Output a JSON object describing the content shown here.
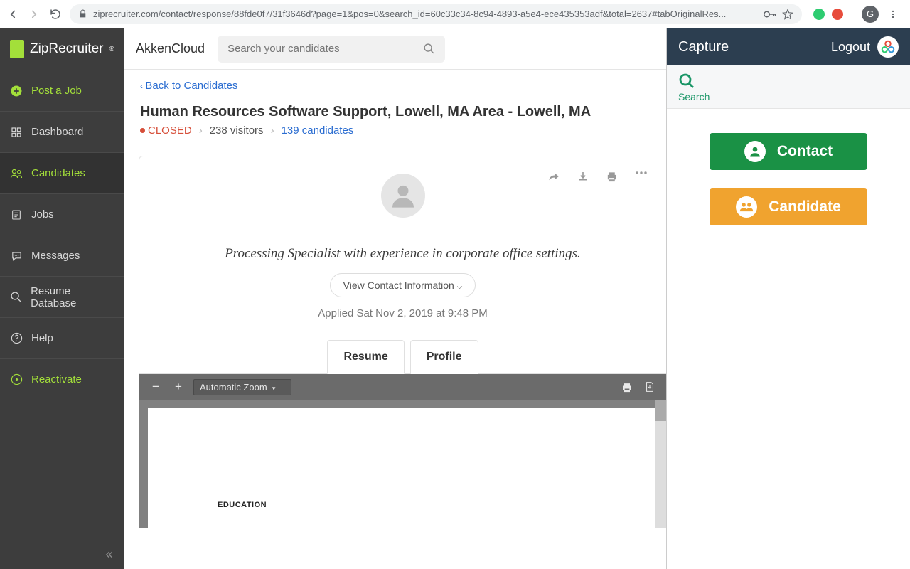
{
  "browser": {
    "url": "ziprecruiter.com/contact/response/88fde0f7/31f3646d?page=1&pos=0&search_id=60c33c34-8c94-4893-a5e4-ece435353adf&total=2637#tabOriginalRes...",
    "avatar_letter": "G"
  },
  "sidebar": {
    "logo": "ZipRecruiter",
    "items": [
      {
        "label": "Post a Job"
      },
      {
        "label": "Dashboard"
      },
      {
        "label": "Candidates"
      },
      {
        "label": "Jobs"
      },
      {
        "label": "Messages"
      },
      {
        "label": "Resume Database"
      },
      {
        "label": "Help"
      },
      {
        "label": "Reactivate"
      }
    ]
  },
  "header": {
    "company": "AkkenCloud",
    "search_placeholder": "Search your candidates"
  },
  "back_link": "Back to Candidates",
  "job": {
    "title": "Human Resources Software Support, Lowell, MA Area - Lowell, MA",
    "status": "CLOSED",
    "visitors": "238 visitors",
    "candidates": "139 candidates"
  },
  "candidate": {
    "headline": "Processing Specialist with experience in corporate office settings.",
    "view_contact": "View Contact Information",
    "applied": "Applied Sat Nov 2, 2019 at 9:48 PM",
    "tabs": {
      "resume": "Resume",
      "profile": "Profile"
    }
  },
  "pdf": {
    "zoom": "Automatic Zoom",
    "section": "EDUCATION"
  },
  "sidepanel": {
    "title": "Capture",
    "logout": "Logout",
    "search_label": "Search",
    "contact_btn": "Contact",
    "candidate_btn": "Candidate"
  }
}
